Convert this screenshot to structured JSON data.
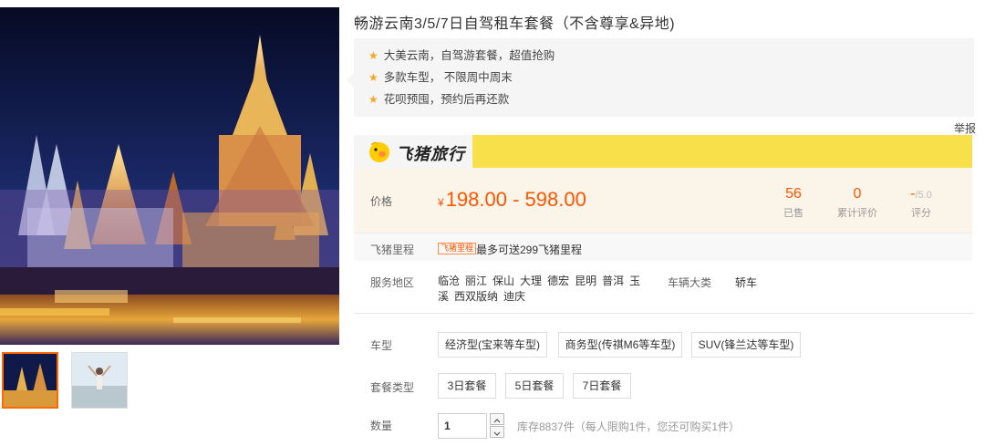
{
  "product": {
    "title": "畅游云南3/5/7日自驾租车套餐（不含尊享&异地)",
    "highlights": [
      "大美云南，自驾游套餐，超值抢购",
      "多款车型， 不限周中周末",
      "花呗预囤，预约后再还款"
    ],
    "report_label": "举报"
  },
  "brand": {
    "name": "飞猪旅行",
    "icon": "pig-logo-icon",
    "bar_color": "#f8e04a"
  },
  "price": {
    "label": "价格",
    "currency": "¥",
    "range": "198.00 - 598.00",
    "color": "#ff5500"
  },
  "stats": {
    "sold_value": "56",
    "sold_label": "已售",
    "reviews_value": "0",
    "reviews_label": "累计评价",
    "score_value": "-",
    "score_max": "/5.0",
    "score_label": "评分"
  },
  "mileage": {
    "label": "飞猪里程",
    "tag": "飞猪里程",
    "text": "最多可送299飞猪里程"
  },
  "service": {
    "label": "服务地区",
    "areas": [
      "临沧",
      "丽江",
      "保山",
      "大理",
      "德宏",
      "昆明",
      "普洱",
      "玉溪",
      "西双版纳",
      "迪庆"
    ],
    "vehicle_label": "车辆大类",
    "vehicle_value": "轿车"
  },
  "options": {
    "car_label": "车型",
    "car_types": [
      "经济型(宝来等车型)",
      "商务型(传祺M6等车型)",
      "SUV(锋兰达等车型)"
    ],
    "package_label": "套餐类型",
    "packages": [
      "3日套餐",
      "5日套餐",
      "7日套餐"
    ],
    "quantity_label": "数量",
    "quantity_value": "1",
    "stock_text": "库存8837件（每人限购1件，您还可购买1件）"
  },
  "gallery": {
    "thumbnails": [
      "thumbnail-night-temple",
      "thumbnail-lakeside-woman"
    ],
    "active": 0
  }
}
